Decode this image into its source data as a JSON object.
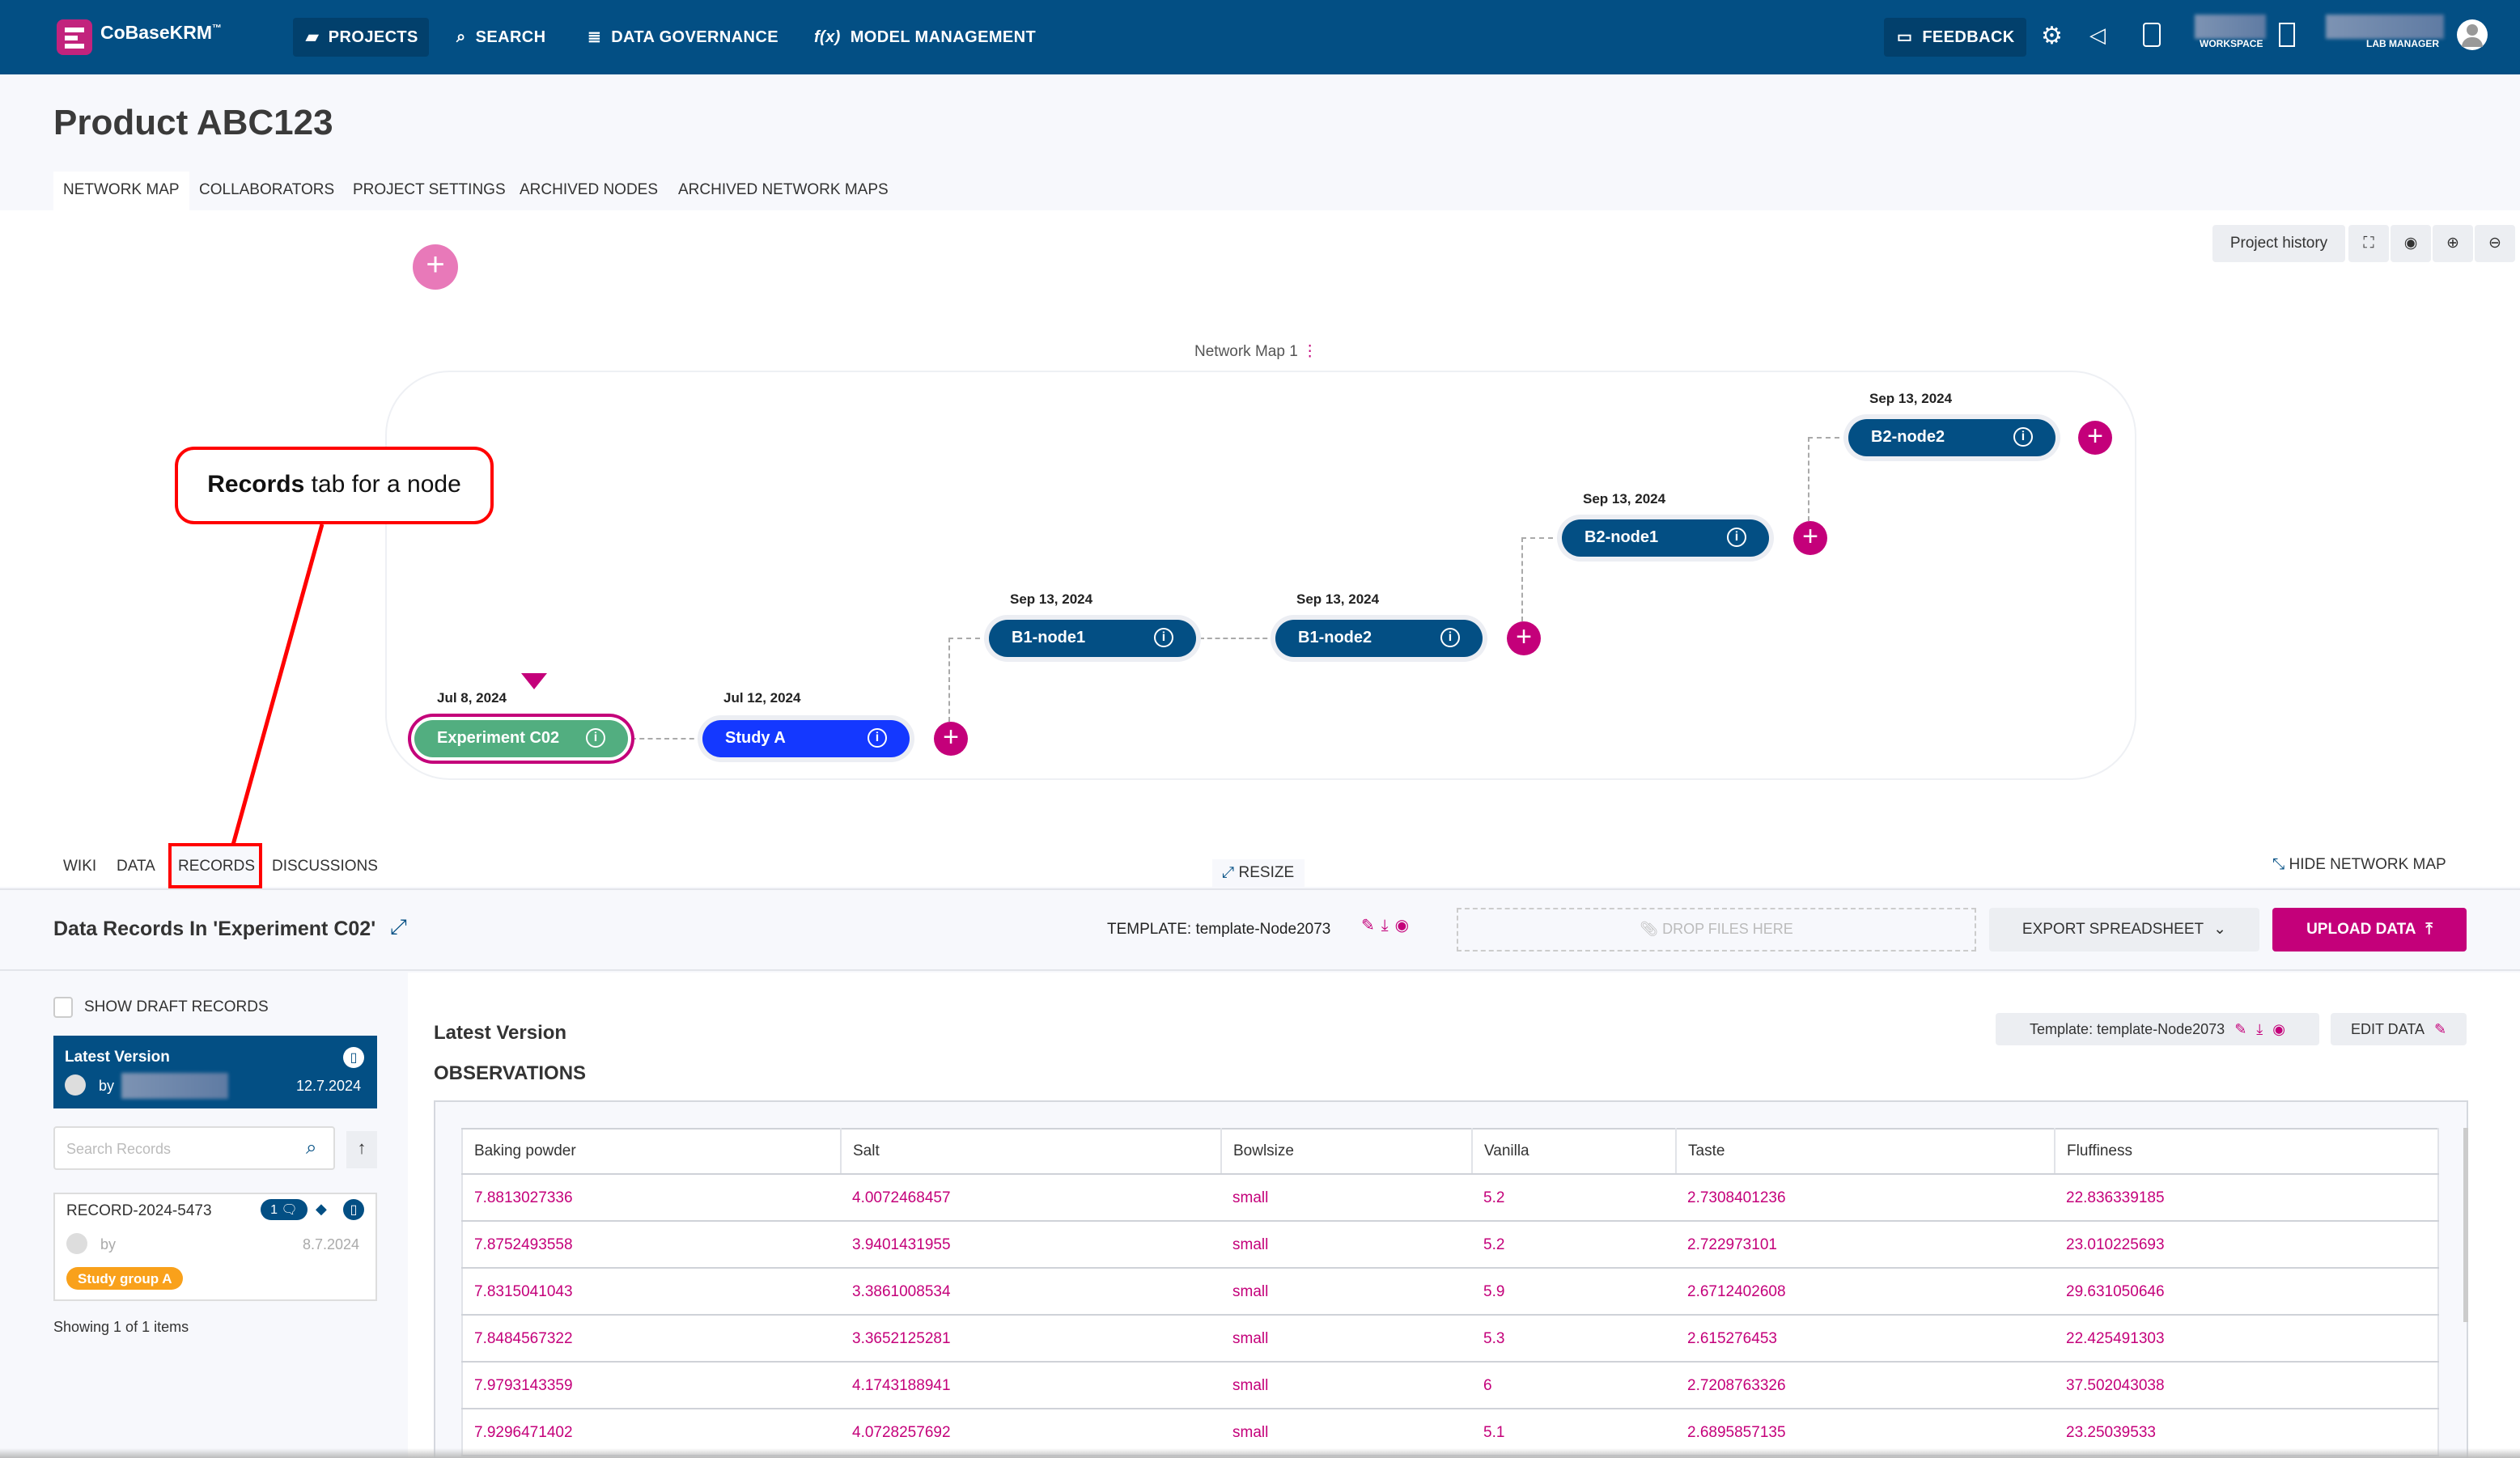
{
  "app": {
    "name": "CoBaseKRM",
    "tm": "™"
  },
  "nav": {
    "projects": "PROJECTS",
    "search": "SEARCH",
    "governance": "DATA GOVERNANCE",
    "model": "MODEL MANAGEMENT",
    "feedback": "FEEDBACK",
    "workspace": "WORKSPACE",
    "role": "LAB MANAGER"
  },
  "page": {
    "title": "Product ABC123",
    "tabs": [
      "NETWORK MAP",
      "COLLABORATORS",
      "PROJECT SETTINGS",
      "ARCHIVED NODES",
      "ARCHIVED NETWORK MAPS"
    ]
  },
  "map": {
    "project_history": "Project history",
    "name": "Network Map 1",
    "nodes": [
      {
        "label": "Experiment C02",
        "date": "Jul 8, 2024"
      },
      {
        "label": "Study A",
        "date": "Jul 12, 2024"
      },
      {
        "label": "B1-node1",
        "date": "Sep 13, 2024"
      },
      {
        "label": "B1-node2",
        "date": "Sep 13, 2024"
      },
      {
        "label": "B2-node1",
        "date": "Sep 13, 2024"
      },
      {
        "label": "B2-node2",
        "date": "Sep 13, 2024"
      }
    ]
  },
  "callout": {
    "bold": "Records",
    "rest": " tab for a node"
  },
  "node_tabs": [
    "WIKI",
    "DATA",
    "RECORDS",
    "DISCUSSIONS"
  ],
  "resize": "RESIZE",
  "hide_map": "HIDE NETWORK MAP",
  "records": {
    "title": "Data Records In 'Experiment C02'",
    "template": "TEMPLATE: template-Node2073",
    "drop": "DROP FILES HERE",
    "export": "EXPORT SPREADSHEET",
    "upload": "UPLOAD DATA",
    "show_draft": "SHOW DRAFT RECORDS",
    "latest_title": "Latest Version",
    "by": "by",
    "latest_date": "12.7.2024",
    "search_placeholder": "Search Records",
    "record_id": "RECORD-2024-5473",
    "comment_count": "1",
    "record_date": "8.7.2024",
    "tag": "Study group A",
    "showing": "Showing 1 of 1 items"
  },
  "main": {
    "version": "Latest Version",
    "section": "OBSERVATIONS",
    "template": "Template: template-Node2073",
    "edit": "EDIT DATA",
    "columns": [
      "Baking powder",
      "Salt",
      "Bowlsize",
      "Vanilla",
      "Taste",
      "Fluffiness"
    ],
    "rows": [
      [
        "7.8813027336",
        "4.0072468457",
        "small",
        "5.2",
        "2.7308401236",
        "22.836339185"
      ],
      [
        "7.8752493558",
        "3.9401431955",
        "small",
        "5.2",
        "2.722973101",
        "23.010225693"
      ],
      [
        "7.8315041043",
        "3.3861008534",
        "small",
        "5.9",
        "2.6712402608",
        "29.631050646"
      ],
      [
        "7.8484567322",
        "3.3652125281",
        "small",
        "5.3",
        "2.615276453",
        "22.425491303"
      ],
      [
        "7.9793143359",
        "4.1743188941",
        "small",
        "6",
        "2.7208763326",
        "37.502043038"
      ],
      [
        "7.9296471402",
        "4.0728257692",
        "small",
        "5.1",
        "2.6895857135",
        "23.25039533"
      ]
    ]
  },
  "colors": {
    "header": "#034f84",
    "accent": "#c4007a",
    "node_dark": "#034f84",
    "node_study": "#1438ff",
    "node_experiment": "#52ae80",
    "callout": "#ff0000",
    "tag": "#f9a11b"
  }
}
